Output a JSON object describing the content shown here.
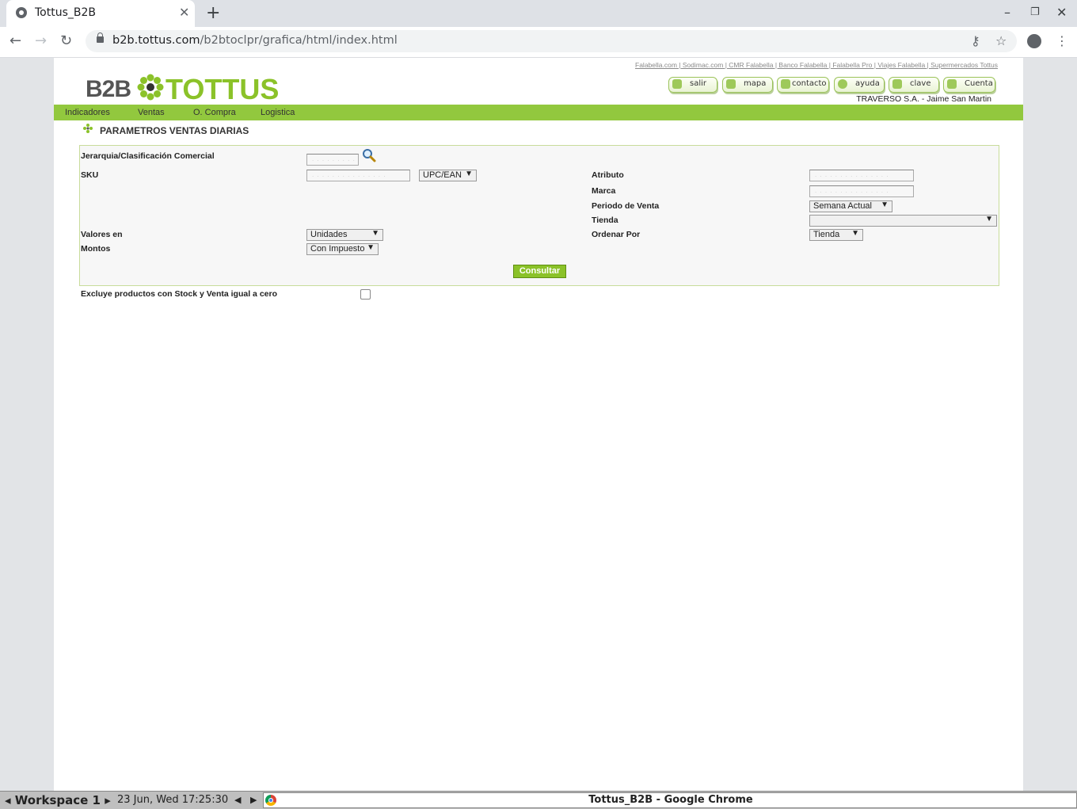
{
  "browser": {
    "tab_title": "Tottus_B2B",
    "url_host": "b2b.tottus.com",
    "url_path": "/b2btoclpr/grafica/html/index.html"
  },
  "header": {
    "top_links": "Falabella.com | Sodimac.com | CMR Falabella | Banco Falabella | Falabella Pro | Viajes Falabella | Supermercados Tottus",
    "logo_b2b": "B2B",
    "logo_tottus": "TOTTUS",
    "buttons": [
      "salir",
      "mapa",
      "contacto",
      "ayuda",
      "clave",
      "Cuenta"
    ],
    "user_info": "TRAVERSO S.A. - Jaime San Martin"
  },
  "menu": [
    "Indicadores",
    "Ventas",
    "O. Compra",
    "Logistica"
  ],
  "section_title": "PARAMETROS VENTAS DIARIAS",
  "form": {
    "jerarquia_label": "Jerarquia/Clasificación Comercial",
    "sku_label": "SKU",
    "sku_type": "UPC/EAN",
    "valores_label": "Valores en",
    "valores_value": "Unidades",
    "montos_label": "Montos",
    "montos_value": "Con Impuesto",
    "atributo_label": "Atributo",
    "marca_label": "Marca",
    "periodo_label": "Periodo de Venta",
    "periodo_value": "Semana Actual",
    "tienda_label": "Tienda",
    "tienda_value": "",
    "ordenar_label": "Ordenar Por",
    "ordenar_value": "Tienda",
    "consultar_label": "Consultar",
    "excluye_label": "Excluye productos con Stock y Venta igual a cero"
  },
  "taskbar": {
    "workspace": "Workspace 1",
    "clock": "23 Jun, Wed 17:25:30",
    "window_title": "Tottus_B2B - Google Chrome"
  },
  "colors": {
    "brand_green": "#8bc229",
    "menu_green": "#92c83e"
  }
}
